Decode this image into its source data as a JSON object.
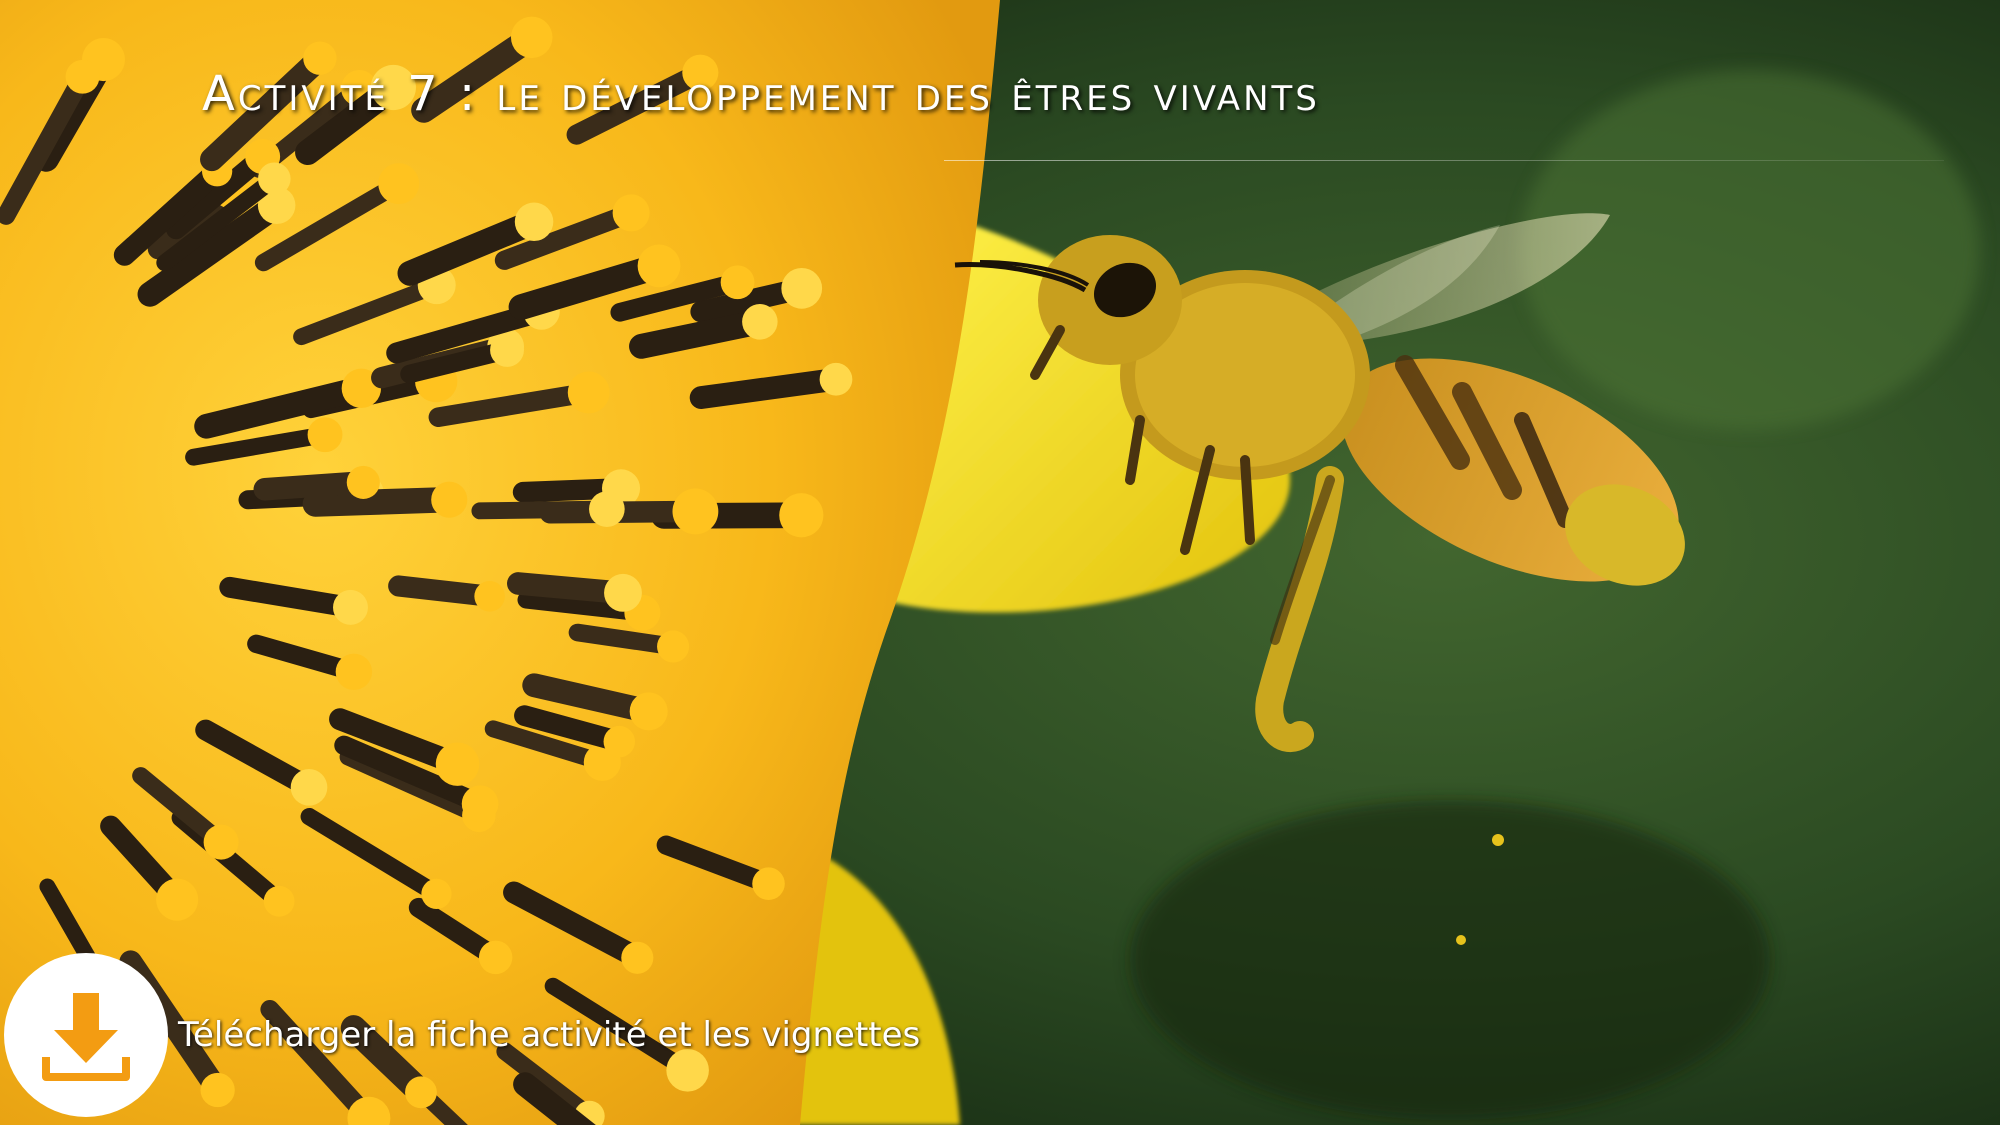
{
  "slide": {
    "title": "Activité 7 : le développement des êtres vivants",
    "photo": {
      "subject": "bee-on-sunflower",
      "colors": {
        "petal": "#f2d21a",
        "stamen": "#f7b51c",
        "background": "#2d4f24"
      }
    }
  },
  "download": {
    "label": "Télécharger la fiche activité et les vignettes",
    "icon": "download-icon",
    "colors": {
      "icon": "#f39c12",
      "circle": "#ffffff"
    }
  }
}
